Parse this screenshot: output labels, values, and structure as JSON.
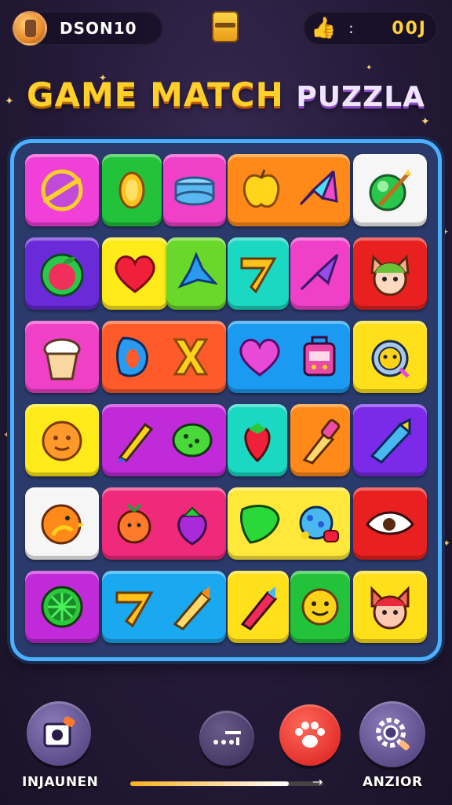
{
  "header": {
    "player_name": "DSON10",
    "score_sep": ":",
    "score": "00J",
    "avatar_icon": "hero-avatar-icon",
    "chest_icon": "treasure-chest-icon",
    "like_icon": "thumbs-up-icon"
  },
  "title": {
    "part1": "GAME",
    "part2": "MATCH",
    "part3": "PUZZLA"
  },
  "board": {
    "rows": 6,
    "columns": 5,
    "tiles": [
      [
        "planet-icon",
        "lemon-slice-icon",
        "bandage-icon",
        "apple-icon",
        "kite-icon",
        "green-ball-icon"
      ],
      [
        "red-apple-icon",
        "heart-icon",
        "blue-star-icon",
        "boomerang-icon",
        "arrow-gem-icon",
        "cat-face-icon"
      ],
      [
        "ice-cream-icon",
        "letter-d-icon",
        "letter-x-icon",
        "purple-heart-icon",
        "robot-toy-icon",
        "owl-face-icon"
      ],
      [
        "cookie-face-icon",
        "pencil-icon",
        "green-blob-icon",
        "strawberry-icon",
        "paint-bottle-icon",
        "crayon-icon"
      ],
      [
        "orange-bird-icon",
        "orange-fruit-face-icon",
        "purple-berry-icon",
        "green-triangle-icon",
        "flower-bug-icon",
        "eye-icon"
      ],
      [
        "watermelon-icon",
        "boomerang-icon",
        "crayon-icon",
        "red-pencil-icon",
        "smiley-icon",
        "fox-face-icon"
      ]
    ]
  },
  "footer": {
    "left_label": "INJAUNEN",
    "right_label": "ANZIOR",
    "left_icon": "camera-shop-icon",
    "dots_icon": "menu-dots-icon",
    "paw_icon": "paw-icon",
    "settings_icon": "settings-gear-icon",
    "progress": 0.82
  },
  "colors": {
    "background": "#241a38",
    "board_border": "#4ab0ff",
    "score": "#ffd23a",
    "title_gold": "#ffcf2a"
  }
}
